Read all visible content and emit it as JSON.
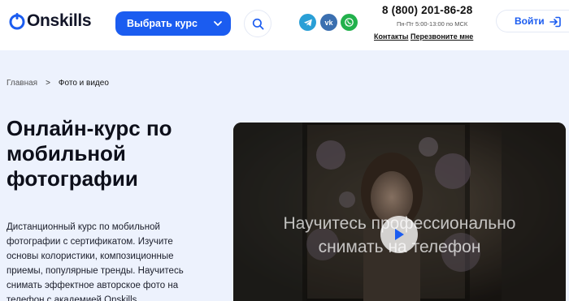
{
  "header": {
    "logo_text": "Onskills",
    "select_course_label": "Выбрать курс",
    "phone": "8 (800) 201-86-28",
    "hours": "Пн-Пт 5:00-13:00 по МСК",
    "contacts_link": "Контакты",
    "callback_link": "Перезвоните мне",
    "login_label": "Войти",
    "social": [
      {
        "name": "telegram",
        "icon": "telegram-icon"
      },
      {
        "name": "vk",
        "icon": "vk-icon",
        "text": "vk"
      },
      {
        "name": "whatsapp",
        "icon": "whatsapp-icon"
      }
    ],
    "accent_color": "#1b5cf0"
  },
  "breadcrumb": {
    "home": "Главная",
    "separator": ">",
    "current": "Фото и видео"
  },
  "hero": {
    "title": "Онлайн-курс по мобильной фотографии",
    "description": "Дистанционный курс по мобильной фотографии с сертификатом. Изучите основы колористики, композиционные приемы, популярные тренды. Научитесь снимать эффектное авторское фото на телефон с академией Onskills."
  },
  "video": {
    "caption_line1": "Научитесь профессионально",
    "caption_line2": "снимать на телефон",
    "play_icon": "play-icon"
  }
}
